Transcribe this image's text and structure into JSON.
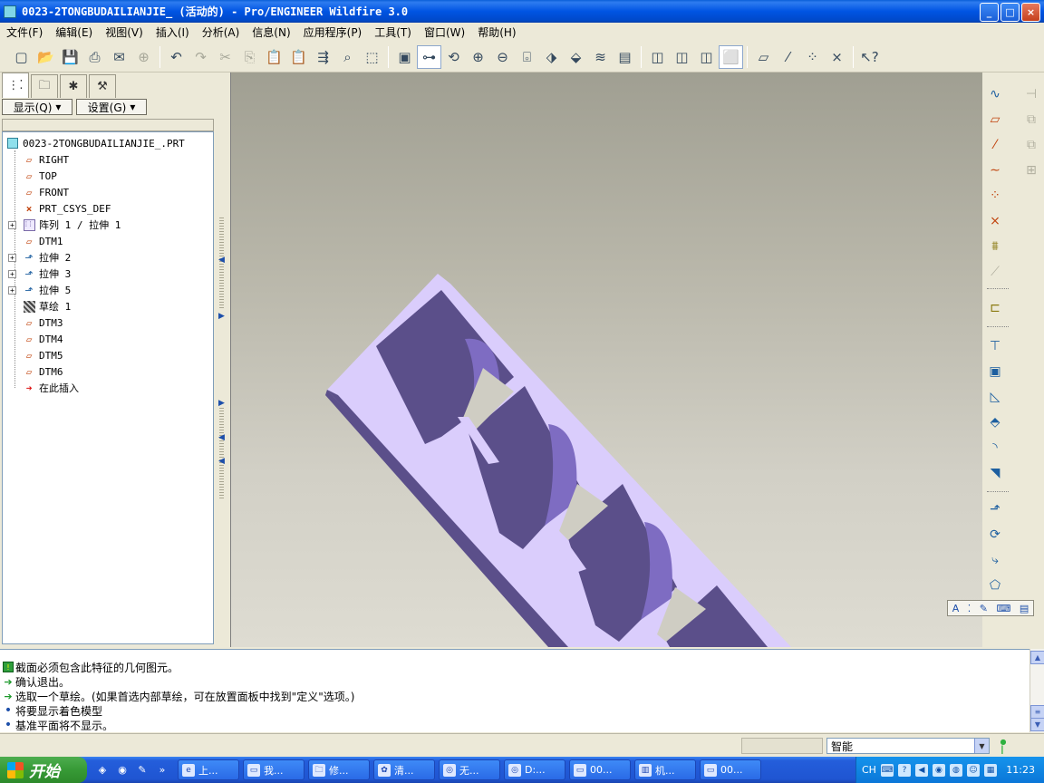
{
  "window": {
    "title": "0023-2TONGBUDAILIANJIE_ (活动的) - Pro/ENGINEER Wildfire 3.0",
    "buttons": [
      "_",
      "□",
      "×"
    ]
  },
  "menu": [
    "文件(F)",
    "编辑(E)",
    "视图(V)",
    "插入(I)",
    "分析(A)",
    "信息(N)",
    "应用程序(P)",
    "工具(T)",
    "窗口(W)",
    "帮助(H)"
  ],
  "navigator": {
    "show_label": "显示(Q)",
    "settings_label": "设置(G)",
    "tree": [
      {
        "label": "0023-2TONGBUDAILIANJIE_.PRT",
        "icon": "part-icon",
        "expandable": false
      },
      {
        "label": "RIGHT",
        "icon": "datum-plane-icon",
        "expandable": false
      },
      {
        "label": "TOP",
        "icon": "datum-plane-icon",
        "expandable": false
      },
      {
        "label": "FRONT",
        "icon": "datum-plane-icon",
        "expandable": false
      },
      {
        "label": "PRT_CSYS_DEF",
        "icon": "csys-icon",
        "expandable": false
      },
      {
        "label": "阵列 1 / 拉伸 1",
        "icon": "pattern-icon",
        "expandable": true
      },
      {
        "label": "DTM1",
        "icon": "datum-plane-icon",
        "expandable": false
      },
      {
        "label": "拉伸 2",
        "icon": "extrude-icon",
        "expandable": true
      },
      {
        "label": "拉伸 3",
        "icon": "extrude-icon",
        "expandable": true
      },
      {
        "label": "拉伸 5",
        "icon": "extrude-icon",
        "expandable": true
      },
      {
        "label": "草绘 1",
        "icon": "sketch-icon",
        "expandable": false
      },
      {
        "label": "DTM3",
        "icon": "datum-plane-icon",
        "expandable": false
      },
      {
        "label": "DTM4",
        "icon": "datum-plane-icon",
        "expandable": false
      },
      {
        "label": "DTM5",
        "icon": "datum-plane-icon",
        "expandable": false
      },
      {
        "label": "DTM6",
        "icon": "datum-plane-icon",
        "expandable": false
      },
      {
        "label": "在此插入",
        "icon": "insert-here-icon",
        "expandable": false
      }
    ]
  },
  "messages": [
    {
      "icon": "warning-icon",
      "text": "截面必须包含此特征的几何图元。"
    },
    {
      "icon": "arrow-icon",
      "text": "确认退出。"
    },
    {
      "icon": "arrow-icon",
      "text": "选取一个草绘。(如果首选内部草绘，可在放置面板中找到\"定义\"选项。)"
    },
    {
      "icon": "bullet-icon",
      "text": "将要显示着色模型"
    },
    {
      "icon": "bullet-icon",
      "text": "基准平面将不显示。"
    }
  ],
  "status": {
    "filter_value": "智能"
  },
  "mini_toolbar": {
    "text_glyph": "A"
  },
  "colors": {
    "model_light": "#dacdfc",
    "model_dark": "#5b4f8a",
    "background_top": "#a09f92",
    "background_bottom": "#dedcd2"
  },
  "taskbar": {
    "start_label": "开始",
    "tasks": [
      "上...",
      "我...",
      "修...",
      "清...",
      "无...",
      "D:...",
      "00...",
      "机...",
      "00..."
    ],
    "tray_lang": "CH",
    "clock": "11:23"
  }
}
